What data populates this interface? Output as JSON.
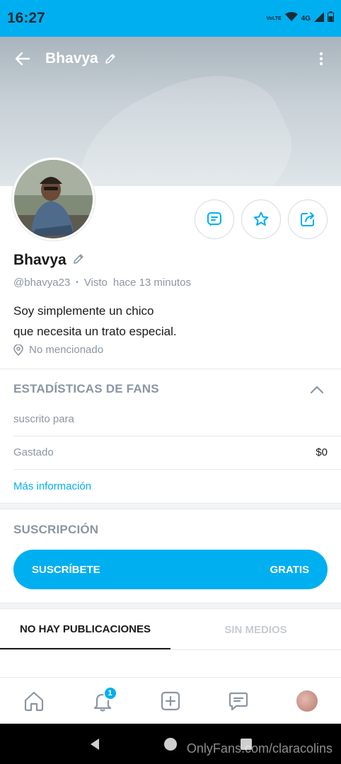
{
  "status_bar": {
    "time": "16:27",
    "volte": "VoLTE",
    "network": "4G"
  },
  "header": {
    "title": "Bhavya"
  },
  "profile": {
    "name": "Bhavya",
    "handle": "@bhavya23",
    "separator": "•",
    "last_seen_label": "Visto",
    "last_seen_value": "hace 13 minutos",
    "bio_line1": "Soy simplemente un chico",
    "bio_line2": "que necesita un trato especial.",
    "location": "No mencionado"
  },
  "fan_stats": {
    "heading": "ESTADÍSTICAS DE FANS",
    "subscribed_label": "suscrito para",
    "spent_label": "Gastado",
    "spent_value": "$0",
    "more_info": "Más información"
  },
  "subscription": {
    "heading": "SUSCRIPCIÓN",
    "button_label": "SUSCRÍBETE",
    "button_price": "GRATIS"
  },
  "tabs": [
    {
      "label": "NO HAY PUBLICACIONES",
      "active": true
    },
    {
      "label": "SIN MEDIOS",
      "active": false
    }
  ],
  "bottom_nav": {
    "notifications_badge": "1"
  },
  "watermark": "OnlyFans.com/claracolins",
  "colors": {
    "accent": "#00aff0",
    "muted": "#8a96a3",
    "text": "#1a1a1a"
  }
}
